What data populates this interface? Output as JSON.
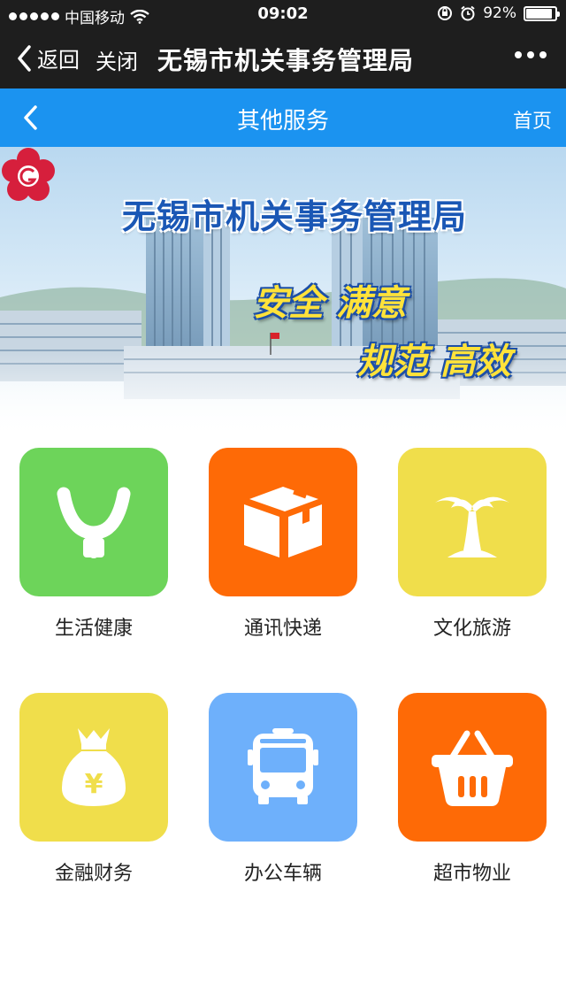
{
  "status_bar": {
    "carrier": "中国移动",
    "time": "09:02",
    "battery": "92%",
    "battery_level": 0.92,
    "icons": [
      "signal-dots-icon",
      "wifi-icon",
      "rotation-lock-icon",
      "alarm-icon",
      "battery-icon"
    ]
  },
  "wechat_header": {
    "back_label": "返回",
    "close_label": "关闭",
    "title": "无锡市机关事务管理局",
    "more_icon": "more-dots-icon"
  },
  "nav": {
    "title": "其他服务",
    "home_label": "首页",
    "back_icon": "chevron-left-icon",
    "color": "#1b93f0"
  },
  "banner": {
    "title": "无锡市机关事务管理局",
    "slogan_line1": "安全 满意",
    "slogan_line2": "规范 高效",
    "logo_icon": "plum-blossom-logo"
  },
  "services": [
    {
      "label": "生活健康",
      "icon": "person-cheer-icon",
      "color": "#6dd45a"
    },
    {
      "label": "通讯快递",
      "icon": "package-box-icon",
      "color": "#fe6a06"
    },
    {
      "label": "文化旅游",
      "icon": "palm-tree-icon",
      "color": "#f0de4b"
    },
    {
      "label": "金融财务",
      "icon": "money-bag-icon",
      "color": "#f0de4b"
    },
    {
      "label": "办公车辆",
      "icon": "bus-icon",
      "color": "#6eb0fb"
    },
    {
      "label": "超市物业",
      "icon": "shopping-basket-icon",
      "color": "#fe6a06"
    }
  ]
}
